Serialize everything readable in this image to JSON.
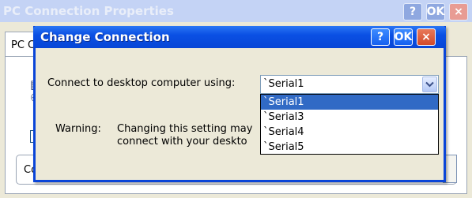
{
  "background_window": {
    "title": "PC Connection Properties",
    "help_label": "?",
    "ok_label": "OK",
    "close_label": "×",
    "tab_label": "PC C",
    "group_label": "Co",
    "checkbox_checked": true
  },
  "dialog": {
    "title": "Change Connection",
    "help_label": "?",
    "ok_label": "OK",
    "close_label": "×",
    "connect_label": "Connect to desktop computer using:",
    "combo_value": "`Serial1",
    "dropdown_options": [
      "`Serial1",
      "`Serial3",
      "`Serial4",
      "`Serial5"
    ],
    "selected_option_index": 0,
    "warning_label": "Warning:",
    "warning_text_line1": "Changing this setting may",
    "warning_text_line2": "connect with your deskto"
  },
  "colors": {
    "dialog_titlebar": "#0a50e4",
    "selection": "#316ac5",
    "window_face": "#ece9d8"
  },
  "icons": {
    "combo_arrow": "chevron-down-icon",
    "checkbox": "checkmark-icon"
  }
}
